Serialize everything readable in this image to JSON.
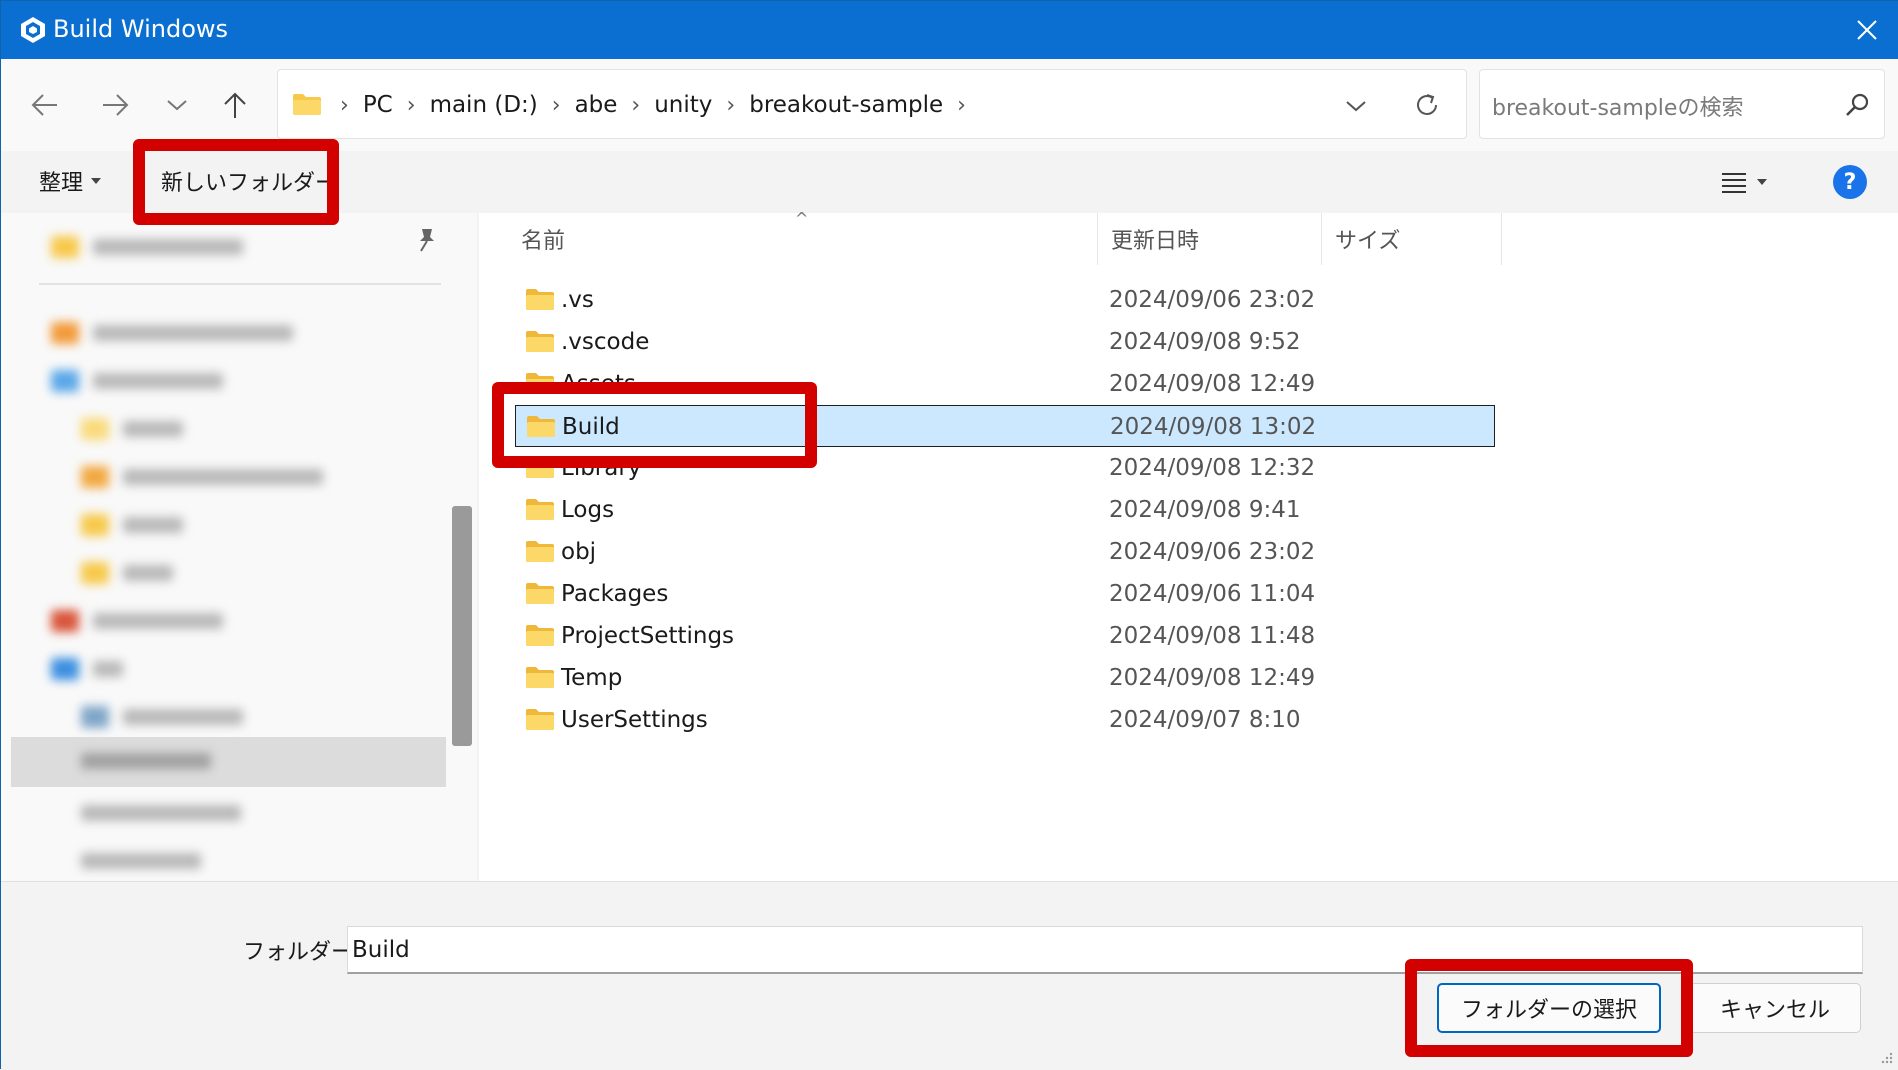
{
  "window": {
    "title": "Build Windows",
    "accent_color": "#0a6fd0"
  },
  "nav": {
    "back_icon": "arrow-left-icon",
    "forward_icon": "arrow-right-icon",
    "recent_icon": "chevron-down-icon",
    "up_icon": "arrow-up-icon",
    "breadcrumbs": [
      "PC",
      "main (D:)",
      "abe",
      "unity",
      "breakout-sample"
    ],
    "search_placeholder": "breakout-sampleの検索"
  },
  "toolbar": {
    "organize_label": "整理",
    "new_folder_label": "新しいフォルダー"
  },
  "list": {
    "columns": {
      "name": "名前",
      "date": "更新日時",
      "size": "サイズ"
    },
    "rows": [
      {
        "name": ".vs",
        "date": "2024/09/06 23:02"
      },
      {
        "name": ".vscode",
        "date": "2024/09/08 9:52"
      },
      {
        "name": "Assets",
        "date": "2024/09/08 12:49"
      },
      {
        "name": "Build",
        "date": "2024/09/08 13:02"
      },
      {
        "name": "Library",
        "date": "2024/09/08 12:32"
      },
      {
        "name": "Logs",
        "date": "2024/09/08 9:41"
      },
      {
        "name": "obj",
        "date": "2024/09/06 23:02"
      },
      {
        "name": "Packages",
        "date": "2024/09/06 11:04"
      },
      {
        "name": "ProjectSettings",
        "date": "2024/09/08 11:48"
      },
      {
        "name": "Temp",
        "date": "2024/09/08 12:49"
      },
      {
        "name": "UserSettings",
        "date": "2024/09/07 8:10"
      }
    ],
    "selected_index": 3
  },
  "footer": {
    "folder_label": "フォルダー:",
    "folder_value": "Build",
    "select_button": "フォルダーの選択",
    "cancel_button": "キャンセル"
  },
  "annotation_color": "#d30000"
}
